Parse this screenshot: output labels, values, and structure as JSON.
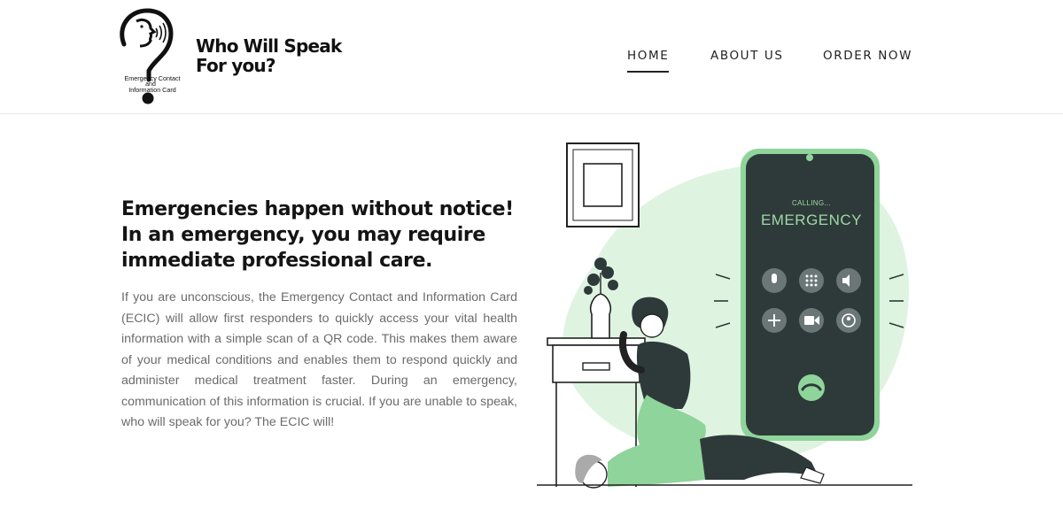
{
  "header": {
    "logo": {
      "alt_text_lines": [
        "Emergency Contact",
        "and",
        "Information Card"
      ],
      "icon": "speaking-head-question-mark-icon"
    },
    "title_line1": "Who Will Speak",
    "title_line2": "For you?"
  },
  "nav": {
    "items": [
      {
        "label": "HOME",
        "active": true
      },
      {
        "label": "ABOUT US",
        "active": false
      },
      {
        "label": "ORDER NOW",
        "active": false
      }
    ]
  },
  "hero": {
    "heading": "Emergencies happen without notice! In an emergency, you may require immediate professional care.",
    "body": "If you are unconscious, the Emergency Contact and Information Card (ECIC) will allow first responders to quickly access your vital health information with a simple scan of a QR code. This makes them aware of your medical conditions and enables them to respond quickly and administer medical treatment faster. During an emergency, communication of this information is crucial. If you are unable to speak, who will speak for you? The ECIC will!"
  },
  "illustration": {
    "phone_status": "CALLING...",
    "phone_caller": "EMERGENCY",
    "call_buttons": [
      "microphone-icon",
      "keypad-icon",
      "speaker-icon",
      "add-call-icon",
      "video-icon",
      "contact-icon"
    ],
    "end_call_icon": "phone-hangup-icon",
    "accent_color": "#8fd49a",
    "light_accent_color": "#dff3e1",
    "phone_color": "#2e3a3a"
  }
}
